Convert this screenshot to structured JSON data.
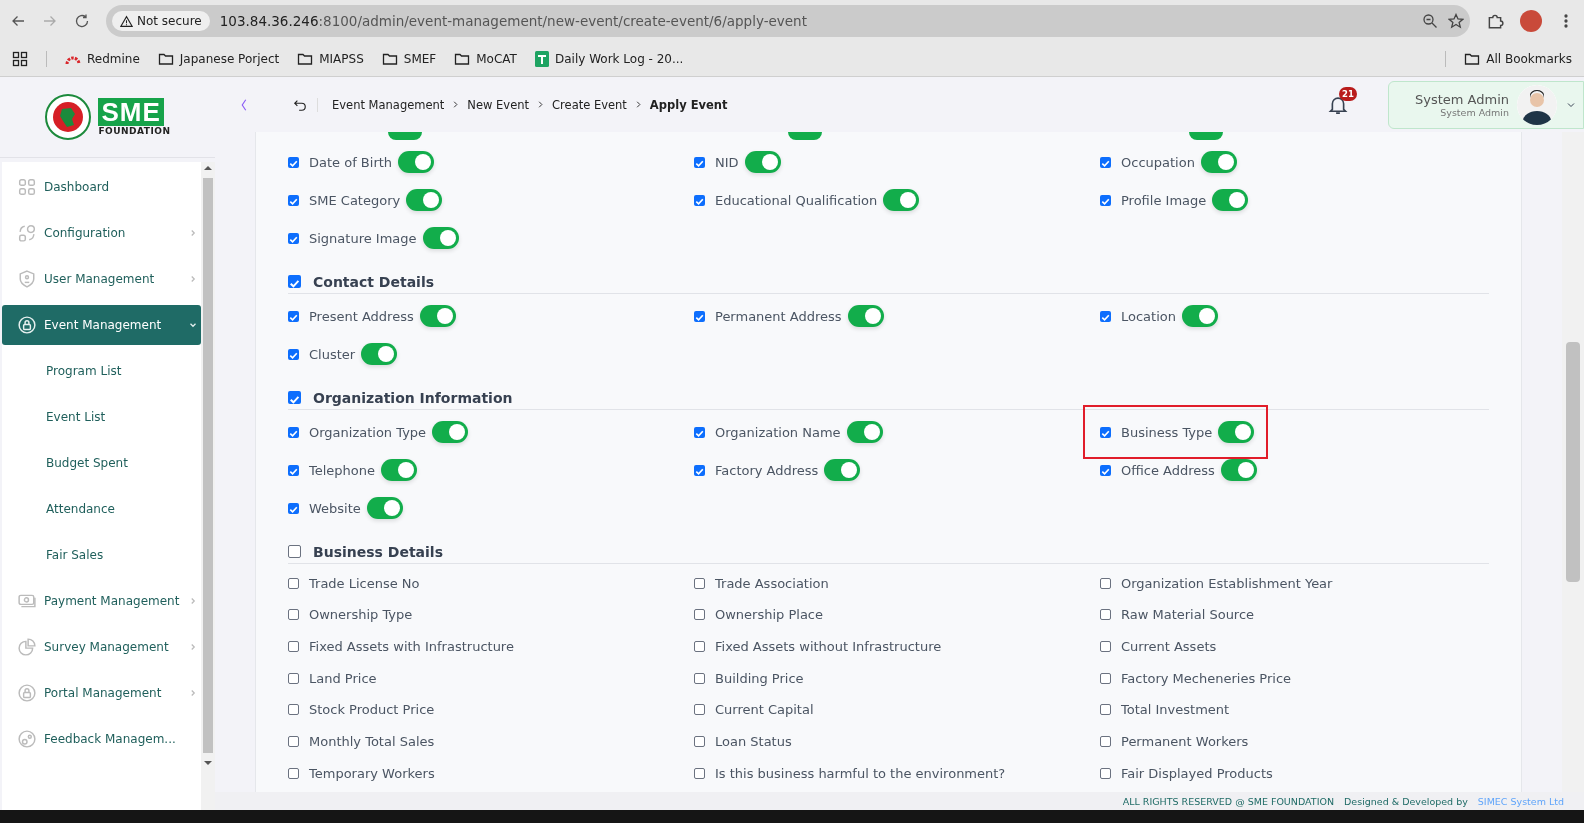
{
  "browser": {
    "security": "Not secure",
    "url_host": "103.84.36.246",
    "url_path": ":8100/admin/event-management/new-event/create-event/6/apply-event",
    "bookmarks": [
      {
        "label": "Redmine",
        "kind": "site"
      },
      {
        "label": "Japanese Porject",
        "kind": "folder"
      },
      {
        "label": "MIAPSS",
        "kind": "folder"
      },
      {
        "label": "SMEF",
        "kind": "folder"
      },
      {
        "label": "MoCAT",
        "kind": "folder"
      },
      {
        "label": "Daily Work Log - 20...",
        "kind": "sheet"
      }
    ],
    "all_bookmarks": "All Bookmarks"
  },
  "logo": {
    "brand": "SME",
    "sub": "FOUNDATION"
  },
  "header": {
    "breadcrumb": [
      "Event Management",
      "New Event",
      "Create Event",
      "Apply Event"
    ],
    "notification_count": "21",
    "user": {
      "name": "System Admin",
      "role": "System Admin"
    }
  },
  "sidebar": {
    "items": [
      {
        "label": "Dashboard",
        "kind": "menu",
        "selected": false,
        "has_children": false
      },
      {
        "label": "Configuration",
        "kind": "menu",
        "selected": false,
        "expanded": false,
        "has_children": true
      },
      {
        "label": "User Management",
        "kind": "menu",
        "selected": false,
        "expanded": false,
        "has_children": true
      },
      {
        "label": "Event Management",
        "kind": "menu",
        "selected": true,
        "expanded": true,
        "has_children": true
      },
      {
        "label": "Program List",
        "kind": "sub",
        "selected": false
      },
      {
        "label": "Event List",
        "kind": "sub",
        "selected": false
      },
      {
        "label": "Budget Spent",
        "kind": "sub",
        "selected": false
      },
      {
        "label": "Attendance",
        "kind": "sub",
        "selected": false
      },
      {
        "label": "Fair Sales",
        "kind": "sub",
        "selected": false
      },
      {
        "label": "Payment Management",
        "kind": "menu",
        "selected": false,
        "expanded": false,
        "has_children": true
      },
      {
        "label": "Survey Management",
        "kind": "menu",
        "selected": false,
        "expanded": false,
        "has_children": true
      },
      {
        "label": "Portal Management",
        "kind": "menu",
        "selected": false,
        "expanded": false,
        "has_children": true
      },
      {
        "label": "Feedback Managem...",
        "kind": "menu",
        "selected": false,
        "has_children": false
      }
    ]
  },
  "sections": [
    {
      "cut_toggles": [
        {
          "on": true
        },
        {
          "on": true
        },
        {
          "on": true
        }
      ],
      "fields": [
        {
          "label": "Date of Birth",
          "checked": true,
          "kind": "toggle",
          "on": true
        },
        {
          "label": "NID",
          "checked": true,
          "kind": "toggle",
          "on": true
        },
        {
          "label": "Occupation",
          "checked": true,
          "kind": "toggle",
          "on": true
        },
        {
          "label": "SME Category",
          "checked": true,
          "kind": "toggle",
          "on": true
        },
        {
          "label": "Educational Qualification",
          "checked": true,
          "kind": "toggle",
          "on": true
        },
        {
          "label": "Profile Image",
          "checked": true,
          "kind": "toggle",
          "on": true
        },
        {
          "label": "Signature Image",
          "checked": true,
          "kind": "toggle",
          "on": true
        }
      ]
    },
    {
      "title": "Contact Details",
      "checked": true,
      "fields": [
        {
          "label": "Present Address",
          "checked": true,
          "kind": "toggle",
          "on": true
        },
        {
          "label": "Permanent Address",
          "checked": true,
          "kind": "toggle",
          "on": true
        },
        {
          "label": "Location",
          "checked": true,
          "kind": "toggle",
          "on": true
        },
        {
          "label": "Cluster",
          "checked": true,
          "kind": "toggle",
          "on": true
        }
      ]
    },
    {
      "title": "Organization Information",
      "checked": true,
      "fields": [
        {
          "label": "Organization Type",
          "checked": true,
          "kind": "toggle",
          "on": true,
          "highlighted": false
        },
        {
          "label": "Organization Name",
          "checked": true,
          "kind": "toggle",
          "on": true,
          "highlighted": false
        },
        {
          "label": "Business Type",
          "checked": true,
          "kind": "toggle",
          "on": true,
          "highlighted": true
        },
        {
          "label": "Telephone",
          "checked": true,
          "kind": "toggle",
          "on": true,
          "highlighted": false
        },
        {
          "label": "Factory Address",
          "checked": true,
          "kind": "toggle",
          "on": true,
          "highlighted": false
        },
        {
          "label": "Office Address",
          "checked": true,
          "kind": "toggle",
          "on": true,
          "highlighted": false
        },
        {
          "label": "Website",
          "checked": true,
          "kind": "toggle",
          "on": true,
          "highlighted": false
        }
      ]
    },
    {
      "title": "Business Details",
      "checked": false,
      "fields": [
        {
          "label": "Trade License No",
          "checked": false,
          "kind": "plain"
        },
        {
          "label": "Trade Association",
          "checked": false,
          "kind": "plain"
        },
        {
          "label": "Organization Establishment Year",
          "checked": false,
          "kind": "plain"
        },
        {
          "label": "Ownership Type",
          "checked": false,
          "kind": "plain"
        },
        {
          "label": "Ownership Place",
          "checked": false,
          "kind": "plain"
        },
        {
          "label": "Raw Material Source",
          "checked": false,
          "kind": "plain"
        },
        {
          "label": "Fixed Assets with Infrastructure",
          "checked": false,
          "kind": "plain"
        },
        {
          "label": "Fixed Assets without Infrastructure",
          "checked": false,
          "kind": "plain"
        },
        {
          "label": "Current Assets",
          "checked": false,
          "kind": "plain"
        },
        {
          "label": "Land Price",
          "checked": false,
          "kind": "plain"
        },
        {
          "label": "Building Price",
          "checked": false,
          "kind": "plain"
        },
        {
          "label": "Factory Mecheneries Price",
          "checked": false,
          "kind": "plain"
        },
        {
          "label": "Stock Product Price",
          "checked": false,
          "kind": "plain"
        },
        {
          "label": "Current Capital",
          "checked": false,
          "kind": "plain"
        },
        {
          "label": "Total Investment",
          "checked": false,
          "kind": "plain"
        },
        {
          "label": "Monthly Total Sales",
          "checked": false,
          "kind": "plain"
        },
        {
          "label": "Loan Status",
          "checked": false,
          "kind": "plain"
        },
        {
          "label": "Permanent Workers",
          "checked": false,
          "kind": "plain"
        },
        {
          "label": "Temporary Workers",
          "checked": false,
          "kind": "plain"
        },
        {
          "label": "Is this business harmful to the environment?",
          "checked": false,
          "kind": "plain"
        },
        {
          "label": "Fair Displayed Products",
          "checked": false,
          "kind": "plain"
        }
      ]
    }
  ],
  "footer": {
    "copyright": "ALL RIGHTS RESERVED @ SME FOUNDATION",
    "credit": "Designed & Developed by",
    "company": "SIMEC System Ltd"
  }
}
